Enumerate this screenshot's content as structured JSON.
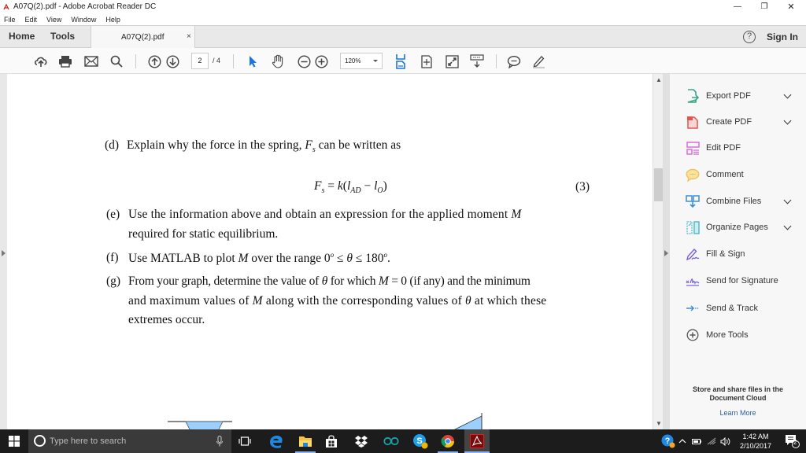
{
  "window": {
    "title": "A07Q(2).pdf - Adobe Acrobat Reader DC",
    "controls": {
      "minimize": "—",
      "restore": "❐",
      "close": "✕"
    }
  },
  "menu": [
    "File",
    "Edit",
    "View",
    "Window",
    "Help"
  ],
  "tabs": {
    "home": "Home",
    "tools": "Tools",
    "document": "A07Q(2).pdf",
    "close": "×",
    "help": "?",
    "sign_in": "Sign In"
  },
  "toolbar": {
    "icons": [
      "upload-cloud-icon",
      "print-icon",
      "email-icon",
      "search-icon",
      "page-up-icon",
      "page-down-icon",
      "select-arrow-icon",
      "hand-tool-icon",
      "zoom-out-icon",
      "zoom-in-icon",
      "fit-width-icon",
      "fit-page-icon",
      "fullscreen-icon",
      "scroll-mode-icon",
      "comment-icon",
      "highlight-pen-icon"
    ],
    "current_page": "2",
    "page_total": "/ 4",
    "zoom": "120%"
  },
  "document": {
    "d_label": "(d)",
    "d_text_1": "Explain why the force in the spring, ",
    "d_var": "F",
    "d_sub": "s",
    "d_text_2": " can be written as",
    "eq_lhs": "F",
    "eq_lhs_sub": "s",
    "eq_mid": " = ",
    "eq_k": "k",
    "eq_open": "(",
    "eq_l1": "l",
    "eq_l1_sub": "AD",
    "eq_minus": " − ",
    "eq_l2": "l",
    "eq_l2_sub": "O",
    "eq_close": ")",
    "eq_number": "(3)",
    "e_label": "(e)",
    "e_line1_a": "Use the information above and obtain an expression for the applied moment ",
    "e_line1_var": "M",
    "e_line2": "required for static equilibrium.",
    "f_label": "(f)",
    "f_text_a": "Use MATLAB to plot ",
    "f_var": "M",
    "f_text_b": " over the range 0",
    "f_deg1": "o",
    "f_leq1": " ≤ ",
    "f_theta": "θ",
    "f_leq2": " ≤ 180",
    "f_deg2": "o",
    "f_end": ".",
    "g_label": "(g)",
    "g_line1_a": "From your graph, determine the value of ",
    "g_theta1": "θ",
    "g_line1_b": " for which ",
    "g_M1": "M",
    "g_line1_c": " = 0 (if any) and the minimum",
    "g_line2_a": "and maximum values of ",
    "g_M2": "M",
    "g_line2_b": " along with the corresponding values of ",
    "g_theta2": "θ",
    "g_line2_c": " at which these",
    "g_line3": "extremes occur."
  },
  "right_panel": {
    "items": [
      {
        "label": "Export PDF",
        "icon": "export-pdf-icon",
        "expandable": true,
        "color": "#3aa68a"
      },
      {
        "label": "Create PDF",
        "icon": "create-pdf-icon",
        "expandable": true,
        "color": "#e2554f"
      },
      {
        "label": "Edit PDF",
        "icon": "edit-pdf-icon",
        "expandable": false,
        "color": "#d765d3"
      },
      {
        "label": "Comment",
        "icon": "comment-icon",
        "expandable": false,
        "color": "#f2c14e"
      },
      {
        "label": "Combine Files",
        "icon": "combine-files-icon",
        "expandable": true,
        "color": "#3b8fd9"
      },
      {
        "label": "Organize Pages",
        "icon": "organize-pages-icon",
        "expandable": true,
        "color": "#49b8c9"
      },
      {
        "label": "Fill & Sign",
        "icon": "fill-sign-icon",
        "expandable": false,
        "color": "#7a5fd6"
      },
      {
        "label": "Send for Signature",
        "icon": "send-signature-icon",
        "expandable": false,
        "color": "#7a5fd6"
      },
      {
        "label": "Send & Track",
        "icon": "send-track-icon",
        "expandable": false,
        "color": "#3b8fd9"
      },
      {
        "label": "More Tools",
        "icon": "more-tools-icon",
        "expandable": false,
        "color": "#555555"
      }
    ],
    "cloud_line1": "Store and share files in the",
    "cloud_line2": "Document Cloud",
    "learn_more": "Learn More"
  },
  "taskbar": {
    "search_placeholder": "Type here to search",
    "apps": [
      "edge-icon",
      "file-explorer-icon",
      "store-icon",
      "dropbox-icon",
      "arduino-icon",
      "skype-icon",
      "chrome-icon",
      "acrobat-icon"
    ],
    "time": "1:42 AM",
    "date": "2/10/2017",
    "notification_count": "2"
  },
  "colors": {
    "accent_blue": "#1a73e8",
    "taskbar_bg": "#1c1c1c",
    "link_blue": "#2b5ca8",
    "figure_fill": "#9ccffc"
  }
}
